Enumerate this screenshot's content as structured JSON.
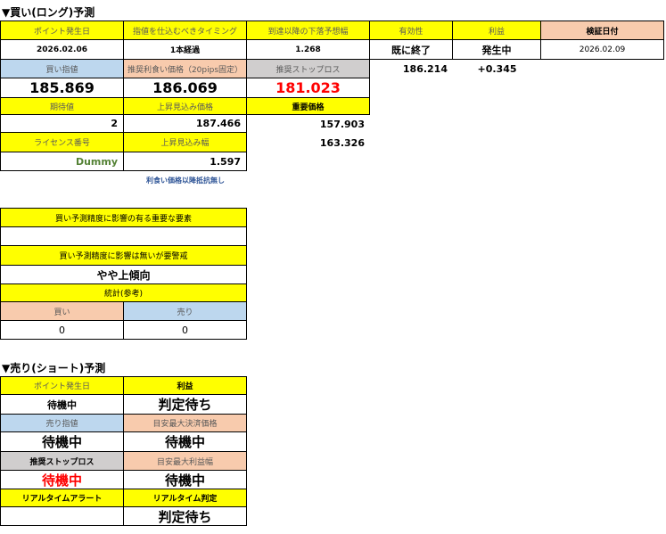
{
  "buy_section": {
    "title": "▼買い(ロング)予測",
    "headers": {
      "point_date": "ポイント発生日",
      "timing": "指値を仕込むべきタイミング",
      "threshold": "到達以降の下落予想幅",
      "validity": "有効性",
      "profit": "利益",
      "verify_date": "検証日付"
    },
    "row1": {
      "point_date": "2026.02.06",
      "timing": "1本経過",
      "threshold": "1.268",
      "validity": "既に終了",
      "profit": "発生中",
      "verify_date": "2026.02.09"
    },
    "headers2": {
      "buy_limit": "買い指値",
      "recommended_tp": "推奨利食い価格（20pips固定）",
      "recommended_sl": "推奨ストップロス"
    },
    "row2": {
      "buy_limit": "185.869",
      "recommended_tp": "186.069",
      "recommended_sl": "181.023",
      "extra_value": "186.214",
      "extra_profit": "+0.345"
    },
    "headers3": {
      "expected": "期待値",
      "rise_price": "上昇見込み価格",
      "important_price": "重要価格"
    },
    "row3": {
      "expected": "2",
      "rise_price": "187.466",
      "important_price_1": "157.903"
    },
    "headers4": {
      "license": "ライセンス番号",
      "rise_width": "上昇見込み幅"
    },
    "row4": {
      "license": "Dummy",
      "rise_width": "1.597",
      "important_price_2": "163.326"
    },
    "note": "利食い価格以降抵抗無し"
  },
  "factors": {
    "good_label": "買い予測精度に影響の有る重要な要素",
    "good_value": "",
    "bad_label": "買い予測精度に影響は無いが要警戒",
    "bad_value": "やや上傾向",
    "stats_label": "統計(参考)",
    "buy_label": "買い",
    "sell_label": "売り",
    "buy_count": "0",
    "sell_count": "0"
  },
  "sell_section": {
    "title": "▼売り(ショート)予測",
    "point_date_label": "ポイント発生日",
    "profit_label": "利益",
    "point_date_value": "待機中",
    "profit_value": "判定待ち",
    "sell_limit_label": "売り指値",
    "max_settle_label": "目安最大決済価格",
    "sell_limit_value": "待機中",
    "max_settle_value": "待機中",
    "sl_label": "推奨ストップロス",
    "max_profit_label": "目安最大利益幅",
    "sl_value": "待機中",
    "max_profit_value": "待機中",
    "alert_label": "リアルタイムアラート",
    "judge_label": "リアルタイム判定",
    "alert_value": "",
    "judge_value": "判定待ち"
  },
  "colors": {
    "yellow": "#ffff00",
    "orange": "#f8cbad",
    "blue": "#bdd7ee",
    "gray": "#d0cece",
    "red": "#ff0000",
    "green": "#548235",
    "note_blue": "#2f5597"
  }
}
